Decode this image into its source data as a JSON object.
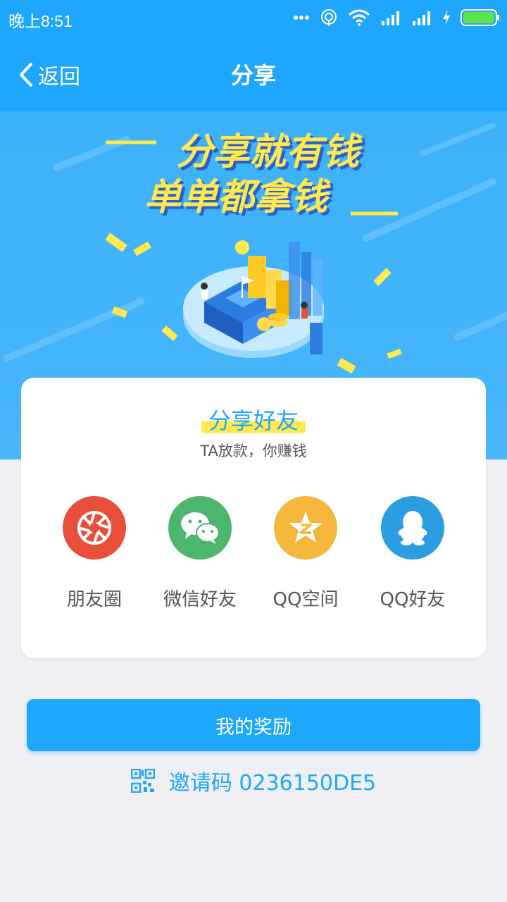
{
  "status": {
    "time": "晚上8:51"
  },
  "header": {
    "back_label": "返回",
    "title": "分享"
  },
  "banner": {
    "line1": "分享就有钱",
    "line2": "单单都拿钱"
  },
  "card": {
    "title": "分享好友",
    "subtitle": "TA放款，你赚钱",
    "items": [
      {
        "label": "朋友圈",
        "color": "#e94e3a",
        "icon": "moments-icon"
      },
      {
        "label": "微信好友",
        "color": "#4cb56e",
        "icon": "wechat-icon"
      },
      {
        "label": "QQ空间",
        "color": "#f4b73b",
        "icon": "qzone-icon"
      },
      {
        "label": "QQ好友",
        "color": "#2a9ee0",
        "icon": "qq-icon"
      }
    ]
  },
  "reward_button": "我的奖励",
  "invite": {
    "label": "邀请码 0236150DE5"
  },
  "colors": {
    "primary": "#1ea7fd",
    "highlight": "#ffe94d"
  }
}
